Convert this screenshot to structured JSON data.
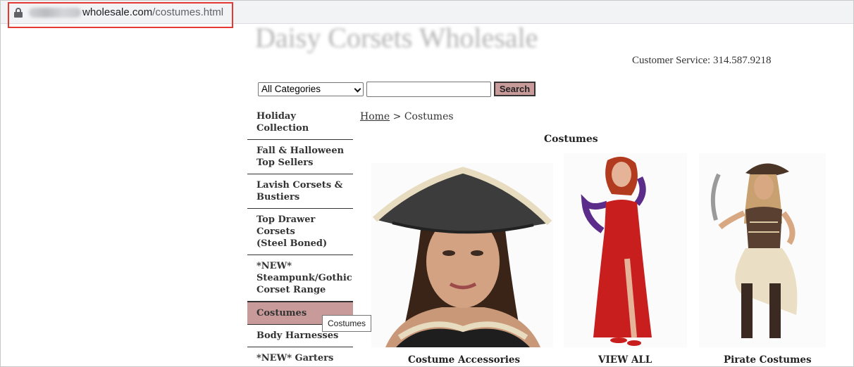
{
  "browser": {
    "url_domain": "wholesale.com",
    "url_path": "/costumes.html"
  },
  "header": {
    "site_title": "Daisy Corsets Wholesale",
    "customer_service": "Customer Service: 314.587.9218"
  },
  "search": {
    "category_selected": "All Categories",
    "input_value": "",
    "button_label": "Search"
  },
  "sidebar": {
    "items": [
      {
        "label_lines": [
          "Holiday Collection"
        ]
      },
      {
        "label_lines": [
          "Fall & Halloween",
          "Top Sellers"
        ]
      },
      {
        "label_lines": [
          "Lavish Corsets &",
          "Bustiers"
        ]
      },
      {
        "label_lines": [
          "Top Drawer Corsets",
          "(Steel Boned)"
        ]
      },
      {
        "label_lines": [
          "*NEW*",
          "Steampunk/Gothic",
          "Corset Range"
        ]
      },
      {
        "label_lines": [
          "Costumes"
        ],
        "active": true
      },
      {
        "label_lines": [
          "Body Harnesses"
        ]
      },
      {
        "label_lines": [
          "*NEW* Garters"
        ]
      }
    ]
  },
  "tooltip": "Costumes",
  "breadcrumb": {
    "home": "Home",
    "separator": " > ",
    "current": "Costumes"
  },
  "content": {
    "heading": "Costumes",
    "products": [
      {
        "caption": "Costume Accessories",
        "image": "pirate-hat-woman-photo"
      },
      {
        "caption": "VIEW ALL",
        "image": "red-sequin-gown-photo"
      },
      {
        "caption": "Pirate Costumes",
        "image": "pirate-costume-photo"
      }
    ]
  },
  "colors": {
    "accent": "#c99a9a",
    "highlight_box": "#e53935"
  }
}
